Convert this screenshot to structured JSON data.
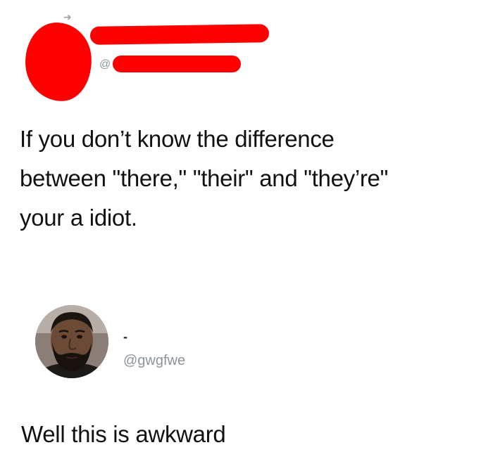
{
  "tweets": [
    {
      "author": {
        "display_name": "",
        "handle_prefix": "@",
        "handle": "",
        "redacted": true,
        "redaction_color": "#ff0000"
      },
      "text": "If you don’t know the difference\nbetween \"there,\" \"their\" and \"they’re\"\nyour a idiot."
    },
    {
      "author": {
        "display_name": "-",
        "handle": "@gwgfwe",
        "avatar_icon": "bearded-man-avatar"
      },
      "text": "Well this is awkward"
    }
  ],
  "colors": {
    "text": "#111111",
    "handle": "#8b949c",
    "background": "#ffffff"
  }
}
